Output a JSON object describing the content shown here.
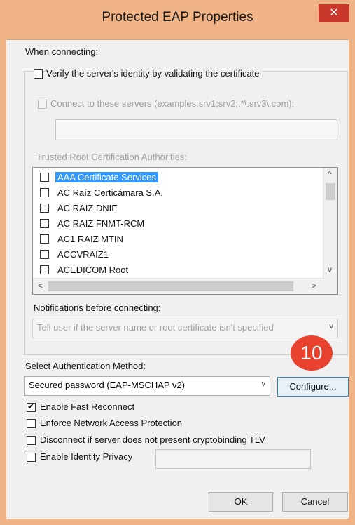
{
  "window": {
    "title": "Protected EAP Properties",
    "close_icon": "close-icon",
    "close_glyph": "✕",
    "accent_color": "#f0b487"
  },
  "when_connecting_label": "When connecting:",
  "verify_identity": {
    "label": "Verify the server's identity by validating the certificate",
    "checked": false
  },
  "connect_servers": {
    "label": "Connect to these servers (examples:srv1;srv2;.*\\.srv3\\.com):",
    "checked": false,
    "enabled": false,
    "value": ""
  },
  "trusted_root_label": "Trusted Root Certification Authorities:",
  "ca_list": [
    {
      "label": "AAA Certificate Services",
      "checked": false,
      "selected": true
    },
    {
      "label": "AC Raíz Certicámara S.A.",
      "checked": false,
      "selected": false
    },
    {
      "label": "AC RAIZ DNIE",
      "checked": false,
      "selected": false
    },
    {
      "label": "AC RAIZ FNMT-RCM",
      "checked": false,
      "selected": false
    },
    {
      "label": "AC1 RAIZ MTIN",
      "checked": false,
      "selected": false
    },
    {
      "label": "ACCVRAIZ1",
      "checked": false,
      "selected": false
    },
    {
      "label": "ACEDICOM Root",
      "checked": false,
      "selected": false
    }
  ],
  "scroll": {
    "up": "^",
    "down": "v",
    "left": "<",
    "right": ">"
  },
  "notifications_label": "Notifications before connecting:",
  "notifications_select": {
    "value": "Tell user if the server name or root certificate isn't specified",
    "enabled": false
  },
  "auth_method_label": "Select Authentication Method:",
  "auth_method_select": {
    "value": "Secured password (EAP-MSCHAP v2)"
  },
  "dropdown_glyph": "v",
  "configure_label": "Configure...",
  "step_badge": "10",
  "options": [
    {
      "label": "Enable Fast Reconnect",
      "checked": true
    },
    {
      "label": "Enforce Network Access Protection",
      "checked": false
    },
    {
      "label": "Disconnect if server does not present cryptobinding TLV",
      "checked": false
    },
    {
      "label": "Enable Identity Privacy",
      "checked": false
    }
  ],
  "identity_privacy_value": "",
  "ok_label": "OK",
  "cancel_label": "Cancel"
}
